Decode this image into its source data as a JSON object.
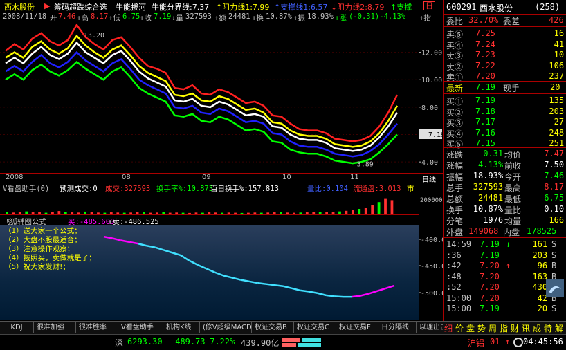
{
  "title_bar": {
    "stock_name": "西水股份",
    "tab_arrow": "▶",
    "formula_name": "筹码超跌综合选",
    "indicator": "牛能拔河",
    "line1": "牛能分界线:7.37",
    "line2": "↑阻力线1:7.99",
    "line3": "↑支撑线1:6.57",
    "line4": "↓阻力线2:8.79",
    "line5": "↑支撑",
    "close_btn": "日"
  },
  "info_line": {
    "date": "2008/11/18",
    "open_label": "开",
    "open": "7.46",
    "high_label": "↑高",
    "high": "8.17",
    "low_label": "↑低",
    "low": "6.75",
    "close_label": "↑收",
    "close": "7.19",
    "vol_label": "↓量",
    "vol": "327593",
    "amt_label": "↑额",
    "amt": "24481",
    "turn_label": "↑换",
    "turn": "10.87%",
    "amp_label": "↑振",
    "amp": "18.93%",
    "chg_label": "↑涨",
    "chg": "(-0.31)-4.13%",
    "tail": "↑指"
  },
  "chart_data": {
    "type": "line",
    "title": "",
    "xlabel": "",
    "ylabel": "",
    "ylim": [
      3.2,
      14.2
    ],
    "y_ticks": [
      "12.00",
      "10.00",
      "8.00",
      "6.00",
      "4.00"
    ],
    "current_price_tag": "7.19",
    "x_labels": [
      "2008",
      "08",
      "09",
      "10",
      "11",
      "日线"
    ],
    "annotations": [
      "13.20",
      "3.89"
    ],
    "x": [
      0,
      3,
      6,
      9,
      12,
      15,
      18,
      21,
      24,
      27,
      30,
      33,
      36,
      39,
      42,
      45,
      48,
      51,
      54,
      57,
      60,
      63,
      66,
      69,
      72,
      75,
      78,
      81,
      84,
      87,
      90,
      93,
      96,
      99,
      102,
      105,
      108,
      111,
      114,
      117,
      120,
      123,
      126,
      129,
      132
    ],
    "series": [
      {
        "color": "#ff2020",
        "values": [
          12.1,
          12.6,
          12.2,
          13.0,
          13.4,
          12.8,
          12.5,
          12.9,
          14.0,
          13.1,
          12.6,
          12.2,
          12.9,
          13.1,
          12.4,
          11.6,
          11.0,
          10.8,
          10.5,
          9.4,
          9.3,
          9.6,
          9.0,
          8.9,
          9.3,
          9.1,
          8.7,
          8.3,
          8.4,
          8.1,
          7.4,
          7.3,
          6.8,
          6.4,
          6.3,
          6.3,
          6.1,
          5.7,
          5.6,
          5.5,
          5.6,
          5.9,
          6.6,
          7.6,
          8.9
        ]
      },
      {
        "color": "#ffff00",
        "values": [
          11.6,
          12.0,
          11.6,
          12.4,
          12.8,
          12.2,
          11.9,
          12.3,
          13.2,
          12.5,
          12.0,
          11.6,
          12.2,
          12.5,
          11.8,
          11.0,
          10.5,
          10.2,
          9.9,
          8.9,
          8.8,
          9.0,
          8.5,
          8.4,
          8.8,
          8.6,
          8.2,
          7.8,
          7.9,
          7.6,
          6.9,
          6.8,
          6.3,
          6.0,
          5.9,
          5.9,
          5.7,
          5.3,
          5.2,
          5.1,
          5.2,
          5.5,
          6.1,
          7.0,
          8.1
        ]
      },
      {
        "color": "#ffffff",
        "values": [
          11.2,
          11.6,
          11.2,
          11.9,
          12.4,
          11.8,
          11.5,
          11.9,
          12.7,
          12.0,
          11.6,
          11.2,
          11.8,
          12.1,
          11.4,
          10.6,
          10.1,
          9.8,
          9.5,
          8.5,
          8.4,
          8.6,
          8.1,
          8.0,
          8.4,
          8.2,
          7.8,
          7.4,
          7.5,
          7.3,
          6.6,
          6.5,
          6.0,
          5.7,
          5.6,
          5.6,
          5.4,
          5.0,
          4.9,
          4.8,
          4.9,
          5.2,
          5.8,
          6.6,
          7.6
        ]
      },
      {
        "color": "#2020ff",
        "values": [
          10.6,
          11.0,
          10.6,
          11.3,
          11.8,
          11.2,
          10.9,
          11.3,
          12.0,
          11.4,
          11.0,
          10.6,
          11.2,
          11.5,
          10.8,
          10.0,
          9.6,
          9.3,
          9.0,
          8.0,
          7.9,
          8.1,
          7.6,
          7.5,
          7.9,
          7.7,
          7.3,
          6.9,
          7.0,
          6.8,
          6.1,
          6.0,
          5.5,
          5.2,
          5.1,
          5.1,
          4.9,
          4.6,
          4.5,
          4.4,
          4.5,
          4.8,
          5.3,
          6.0,
          6.8
        ]
      },
      {
        "color": "#00ff00",
        "values": [
          10.0,
          10.4,
          10.0,
          10.7,
          11.1,
          10.6,
          10.3,
          10.7,
          11.3,
          10.8,
          10.4,
          10.0,
          10.6,
          10.9,
          10.2,
          9.4,
          9.0,
          8.7,
          8.4,
          7.4,
          7.3,
          7.5,
          7.0,
          6.9,
          7.3,
          7.1,
          6.7,
          6.3,
          6.4,
          6.2,
          5.5,
          5.4,
          4.9,
          4.7,
          4.6,
          4.6,
          4.4,
          4.1,
          4.0,
          3.9,
          4.0,
          4.2,
          4.7,
          5.3,
          6.0
        ]
      }
    ]
  },
  "volume_panel": {
    "header_title": "V看盘助手(0)",
    "forecast": "预测成交:0",
    "vol": "成交:327593",
    "turnover": "换手率%:10.873",
    "daily_turn": "百日换手%:157.813",
    "ratio": "量比:0.104",
    "float": "流通盘:3.013",
    "tail": "市",
    "axis_tick": "200000",
    "bars": [
      0.08,
      0.06,
      0.1,
      0.12,
      0.07,
      0.09,
      0.05,
      0.08,
      0.14,
      0.09,
      0.07,
      0.06,
      0.11,
      0.08,
      0.06,
      0.05,
      0.07,
      0.06,
      0.05,
      0.06,
      0.08,
      0.07,
      0.05,
      0.06,
      0.07,
      0.05,
      0.06,
      0.05,
      0.04,
      0.06,
      0.05,
      0.07,
      0.06,
      0.05,
      0.06,
      0.05,
      0.04,
      0.05,
      0.06,
      0.05,
      0.06,
      0.07,
      0.08,
      0.06,
      0.05,
      0.06,
      0.07,
      0.08,
      0.1,
      0.09,
      0.08,
      0.12,
      0.15,
      0.2,
      0.25,
      0.32,
      0.45,
      0.6,
      0.8,
      0.7
    ]
  },
  "indicator_panel": {
    "title": "飞狐辅图公式",
    "buy": "买:-485.600",
    "sell": "↑卖:-486.525",
    "sell_arrow": "↑",
    "notes": [
      "（1）送大家一个公式；",
      "（2）大盘不股最适合；",
      "（3）注意操作观察；",
      "（4）按照买，卖做就是了；",
      "（5）祝大家发财!；"
    ],
    "axis_ticks": [
      "-400.0",
      "-450.0",
      "-500.0"
    ],
    "curve": [
      -395,
      -398,
      -402,
      -405,
      -408,
      -412,
      -415,
      -420,
      -425,
      -430,
      -440,
      -448,
      -455,
      -462,
      -468,
      -472,
      -476,
      -479,
      -482,
      -484,
      -486,
      -488,
      -492,
      -496,
      -498,
      -501,
      -505,
      -507,
      -508,
      -508,
      -506,
      -502,
      -497,
      -492,
      -487
    ]
  },
  "tab_bar": {
    "tabs": [
      "KDJ",
      "很准加强",
      "很准胜率",
      "V看盘助手",
      "机构K线",
      "(修V超级MACD",
      "权证交易B",
      "权证交易C",
      "权证交易F",
      "日分隔线",
      "以理出击"
    ]
  },
  "func_bar": {
    "items": [
      "细",
      "价",
      "盘",
      "势",
      "周",
      "指",
      "财",
      "讯",
      "成",
      "特",
      "解"
    ]
  },
  "status_bar": {
    "market": "深",
    "index": "6293.30",
    "change": "-489.73",
    "pct": "-7.22%",
    "amount": "439.90亿",
    "market2": "沪铝",
    "market2_val": "01",
    "arrow": "↑",
    "time": "04:45:56"
  },
  "right_panel": {
    "code": "600291",
    "name": "西水股份",
    "count": "(258)",
    "wb_label": "委比",
    "wb": "32.70%",
    "wc_label": "委差",
    "wc": "426",
    "asks": [
      {
        "label": "卖⑤",
        "price": "7.25",
        "vol": "16"
      },
      {
        "label": "卖④",
        "price": "7.24",
        "vol": "41"
      },
      {
        "label": "卖③",
        "price": "7.23",
        "vol": "10"
      },
      {
        "label": "卖②",
        "price": "7.22",
        "vol": "106"
      },
      {
        "label": "卖①",
        "price": "7.20",
        "vol": "237"
      }
    ],
    "last_label": "最新",
    "last": "7.19",
    "hand_label": "现手",
    "hand": "20",
    "bids": [
      {
        "label": "买①",
        "price": "7.19",
        "vol": "135"
      },
      {
        "label": "买②",
        "price": "7.18",
        "vol": "203"
      },
      {
        "label": "买③",
        "price": "7.17",
        "vol": "27"
      },
      {
        "label": "买④",
        "price": "7.16",
        "vol": "248"
      },
      {
        "label": "买⑤",
        "price": "7.15",
        "vol": "251"
      }
    ],
    "stats": [
      {
        "l1": "涨跌",
        "v1": "-0.31",
        "l2": "均价",
        "v2": "7.47"
      },
      {
        "l1": "涨幅",
        "v1": "-4.13%",
        "l2": "前收",
        "v2": "7.50"
      },
      {
        "l1": "振幅",
        "v1": "18.93%",
        "l2": "今开",
        "v2": "7.46"
      },
      {
        "l1": "总手",
        "v1": "327593",
        "l2": "最高",
        "v2": "8.17"
      },
      {
        "l1": "总额",
        "v1": "24481",
        "l2": "最低",
        "v2": "6.75"
      },
      {
        "l1": "换手",
        "v1": "10.87%",
        "l2": "量比",
        "v2": "0.10"
      },
      {
        "l1": "分笔",
        "v1": "1976",
        "l2": "均量",
        "v2": "166"
      }
    ],
    "outer_label": "外盘",
    "outer": "149068",
    "inner_label": "内盘",
    "inner": "178525",
    "ticks": [
      {
        "time": "14:59",
        "price": "7.19",
        "arrow": "↓",
        "vol": "161",
        "side": "S"
      },
      {
        "time": ":36",
        "price": "7.19",
        "arrow": "",
        "vol": "203",
        "side": "S"
      },
      {
        "time": ":42",
        "price": "7.20",
        "arrow": "↑",
        "vol": "96",
        "side": "B"
      },
      {
        "time": ":48",
        "price": "7.20",
        "arrow": "",
        "vol": "163",
        "side": "B"
      },
      {
        "time": ":52",
        "price": "7.20",
        "arrow": "",
        "vol": "430",
        "side": "B"
      },
      {
        "time": "15:00",
        "price": "7.20",
        "arrow": "",
        "vol": "42",
        "side": "B"
      },
      {
        "time": "15:00",
        "price": "7.19",
        "arrow": "",
        "vol": "20",
        "side": "S"
      }
    ],
    "colors": {
      "up": "#ff3030",
      "down": "#00ff00",
      "flat": "#ffffff",
      "label": "#c0c0c0",
      "yellow": "#ffff00"
    }
  }
}
